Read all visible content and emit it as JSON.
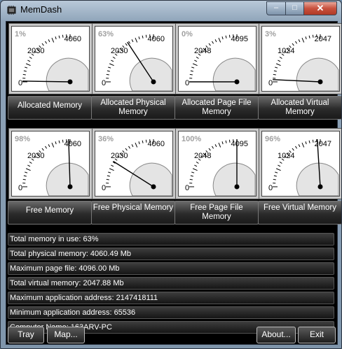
{
  "window": {
    "title": "MemDash"
  },
  "gauges": [
    {
      "label": "Allocated Memory",
      "pct": "1%",
      "max": "4060",
      "mid": "2030",
      "min": "0"
    },
    {
      "label": "Allocated Physical Memory",
      "pct": "63%",
      "max": "4060",
      "mid": "2030",
      "min": "0"
    },
    {
      "label": "Allocated Page File Memory",
      "pct": "0%",
      "max": "4095",
      "mid": "2048",
      "min": "0"
    },
    {
      "label": "Allocated Virtual Memory",
      "pct": "3%",
      "max": "2047",
      "mid": "1024",
      "min": "0"
    },
    {
      "label": "Free Memory",
      "pct": "98%",
      "max": "4060",
      "mid": "2030",
      "min": "0"
    },
    {
      "label": "Free Physical Memory",
      "pct": "36%",
      "max": "4060",
      "mid": "2030",
      "min": "0"
    },
    {
      "label": "Free Page File Memory",
      "pct": "100%",
      "max": "4095",
      "mid": "2048",
      "min": "0"
    },
    {
      "label": "Free Virtual Memory",
      "pct": "96%",
      "max": "2047",
      "mid": "1024",
      "min": "0"
    }
  ],
  "info": [
    "Total memory in use:  63%",
    "Total physical memory: 4060.49 Mb",
    "Maximum page file:  4096.00 Mb",
    "Total virtual memory:  2047.88 Mb",
    "Maximum application address:  2147418111",
    "Minimum application address:  65536",
    "Computer Name:  163ARV-PC"
  ],
  "buttons": {
    "tray": "Tray",
    "map": "Map...",
    "about": "About...",
    "exit": "Exit"
  }
}
